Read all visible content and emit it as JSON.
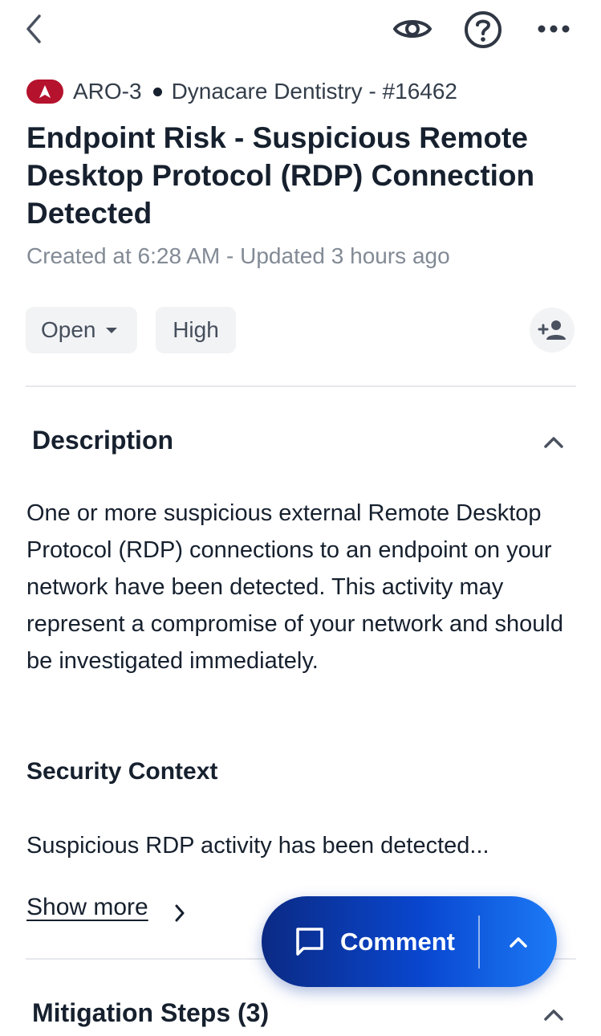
{
  "header": {
    "back_icon": "chevron-left-icon",
    "watch_icon": "eye-icon",
    "help_icon": "question-circle-icon",
    "more_icon": "ellipsis-icon"
  },
  "alert": {
    "logo_icon": "brand-a-logo",
    "code": "ARO-3",
    "customer_ref": "Dynacare Dentistry - #16462",
    "title": "Endpoint Risk - Suspicious Remote Desktop Protocol (RDP) Connection Detected",
    "timestamps": "Created at 6:28 AM - Updated 3 hours ago",
    "status": "Open",
    "priority": "High",
    "assign_icon": "add-person-icon"
  },
  "description": {
    "heading": "Description",
    "body": "One or more suspicious external Remote Desktop Protocol (RDP) connections to an endpoint on your network have been detected. This activity may represent a compromise of your network and should be investigated immediately.",
    "security_context_heading": "Security Context",
    "security_context_preview": "Suspicious RDP activity has been detected...",
    "show_more_label": "Show more"
  },
  "mitigation": {
    "heading": "Mitigation Steps (3)"
  },
  "comment_fab": {
    "label": "Comment",
    "icon": "chat-bubble-icon",
    "expand_icon": "chevron-up-icon"
  },
  "colors": {
    "brand_red": "#b5122e",
    "fab_gradient_start": "#0b2a84",
    "fab_gradient_end": "#1c7af6",
    "text_primary": "#16202e",
    "text_muted": "#828a95"
  }
}
